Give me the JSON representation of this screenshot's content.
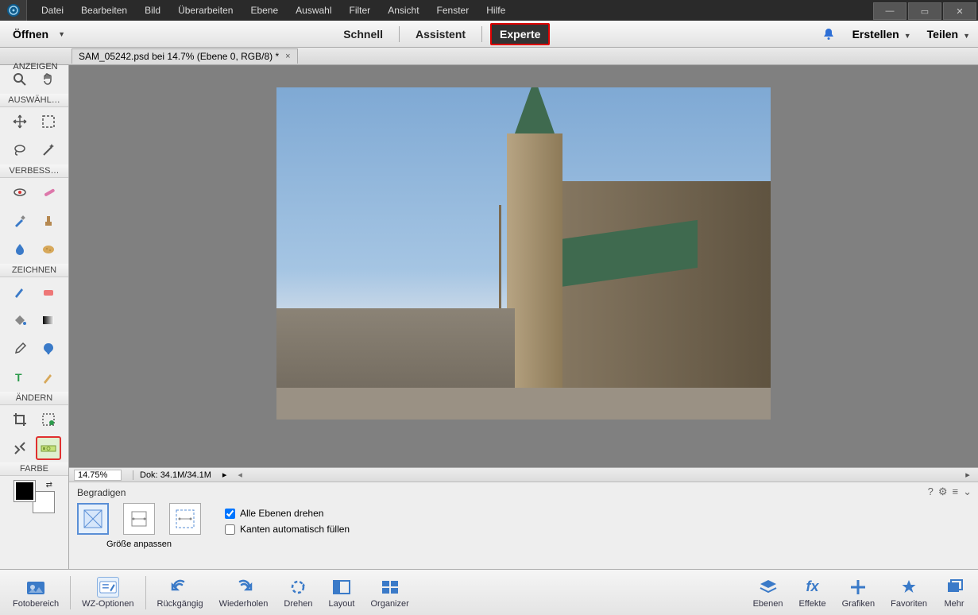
{
  "menu": {
    "items": [
      "Datei",
      "Bearbeiten",
      "Bild",
      "Überarbeiten",
      "Ebene",
      "Auswahl",
      "Filter",
      "Ansicht",
      "Fenster",
      "Hilfe"
    ]
  },
  "modebar": {
    "open": "Öffnen",
    "modes": {
      "quick": "Schnell",
      "guided": "Assistent",
      "expert": "Experte"
    },
    "create": "Erstellen",
    "share": "Teilen"
  },
  "doc": {
    "tab_title": "SAM_05242.psd bei 14.7% (Ebene 0, RGB/8) *",
    "zoom": "14.75%",
    "docsize_label": "Dok:",
    "docsize": "34.1M/34.1M"
  },
  "toolbox": {
    "hdr_view": "ANZEIGEN",
    "hdr_select": "AUSWÄHL…",
    "hdr_enhance": "VERBESS…",
    "hdr_draw": "ZEICHNEN",
    "hdr_modify": "ÄNDERN",
    "hdr_color": "FARBE"
  },
  "options": {
    "title": "Begradigen",
    "caption": "Größe anpassen",
    "chk_all_layers": "Alle Ebenen drehen",
    "chk_auto_fill": "Kanten automatisch füllen"
  },
  "bottom": {
    "fotobereich": "Fotobereich",
    "wz": "WZ-Optionen",
    "undo": "Rückgängig",
    "redo": "Wiederholen",
    "rotate": "Drehen",
    "layout": "Layout",
    "organizer": "Organizer",
    "ebenen": "Ebenen",
    "effekte": "Effekte",
    "grafiken": "Grafiken",
    "favoriten": "Favoriten",
    "mehr": "Mehr"
  }
}
